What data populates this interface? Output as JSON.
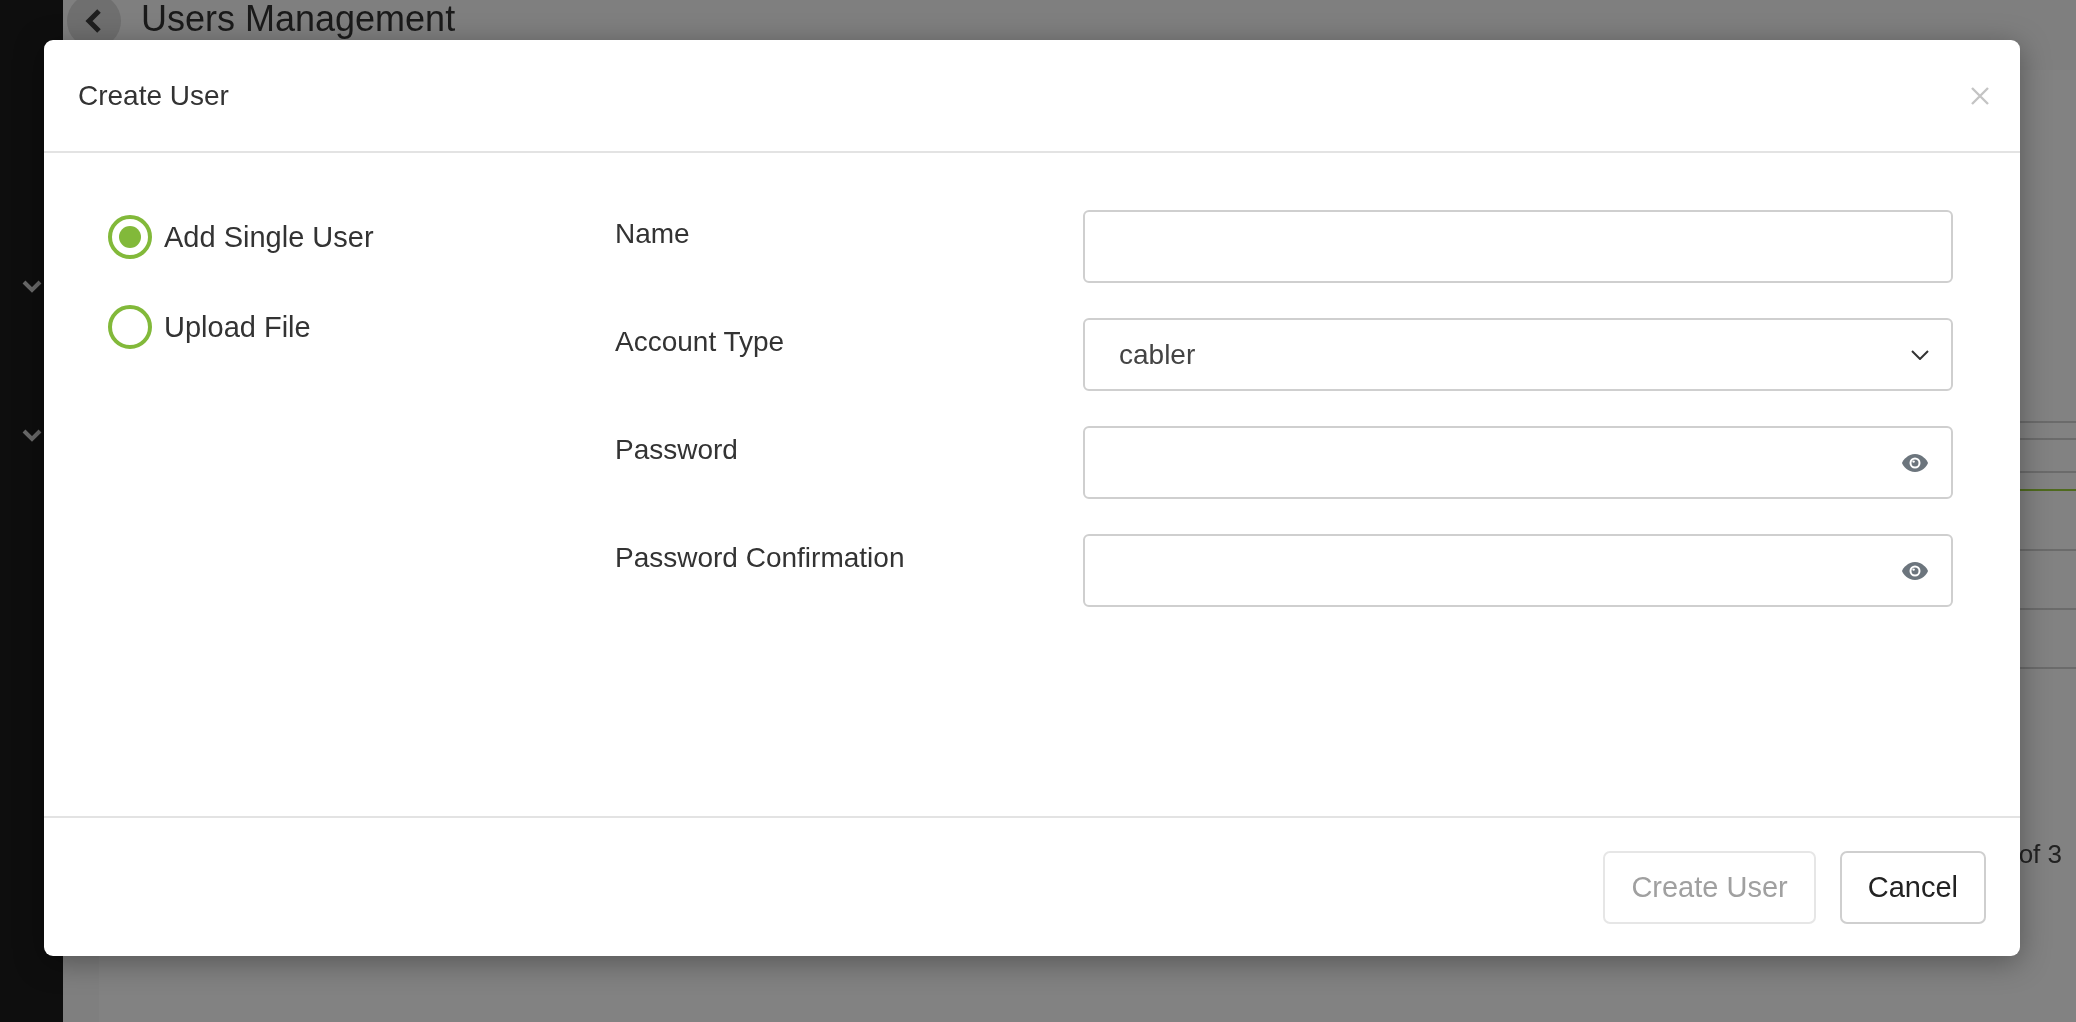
{
  "page": {
    "title": "Users Management",
    "pagination_text": "of 3"
  },
  "dialog": {
    "title": "Create User",
    "modes": [
      {
        "label": "Add Single User",
        "selected": true
      },
      {
        "label": "Upload File",
        "selected": false
      }
    ],
    "fields": [
      {
        "label": "Name",
        "kind": "text"
      },
      {
        "label": "Account Type",
        "kind": "select",
        "value": "cabler"
      },
      {
        "label": "Password",
        "kind": "password"
      },
      {
        "label": "Password Confirmation",
        "kind": "password"
      }
    ],
    "buttons": [
      {
        "label": "Create User",
        "disabled": true
      },
      {
        "label": "Cancel",
        "disabled": false
      }
    ]
  }
}
